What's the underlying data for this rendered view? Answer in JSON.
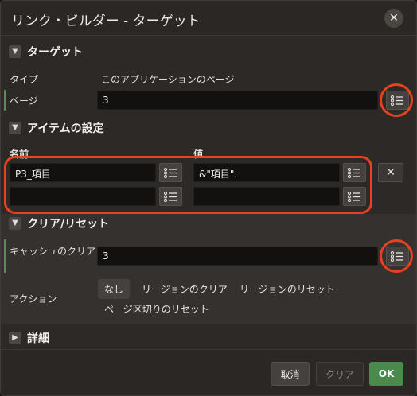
{
  "dialog": {
    "title": "リンク・ビルダー - ターゲット",
    "close_glyph": "✕"
  },
  "target": {
    "header": "ターゲット",
    "type_label": "タイプ",
    "type_value": "このアプリケーションのページ",
    "page_label": "ページ",
    "page_value": "3"
  },
  "items": {
    "header": "アイテムの設定",
    "name_col": "名前",
    "value_col": "値",
    "rows": [
      {
        "name": "P3_項目",
        "value": "&\"項目\"."
      },
      {
        "name": "",
        "value": ""
      }
    ],
    "remove_glyph": "✕"
  },
  "clear": {
    "header": "クリア/リセット",
    "cache_label": "キャッシュのクリア",
    "cache_value": "3",
    "action_label": "アクション",
    "actions": [
      "なし",
      "リージョンのクリア",
      "リージョンのリセット",
      "ページ区切りのリセット"
    ],
    "selected_action": "なし"
  },
  "details": {
    "header": "詳細"
  },
  "footer": {
    "cancel": "取消",
    "clear": "クリア",
    "ok": "OK"
  },
  "icons": {
    "expanded": "chevron-down-icon",
    "collapsed": "chevron-right-icon",
    "list": "list-icon",
    "close": "close-icon"
  },
  "colors": {
    "accent_ok": "#4b8a4d",
    "highlight_ring": "#e8411f",
    "required_bar": "#5c8a5c"
  }
}
